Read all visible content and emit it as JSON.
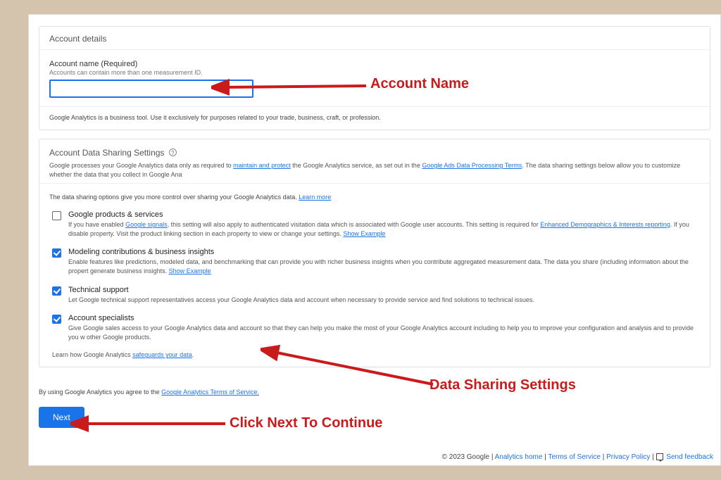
{
  "account_details": {
    "header": "Account details",
    "name_label": "Account name (Required)",
    "name_sublabel": "Accounts can contain more than one measurement ID.",
    "name_value": "",
    "disclaimer": "Google Analytics is a business tool. Use it exclusively for purposes related to your trade, business, craft, or profession."
  },
  "data_sharing": {
    "header": "Account Data Sharing Settings",
    "sub_pre": "Google processes your Google Analytics data only as required to ",
    "sub_link1": "maintain and protect",
    "sub_mid": " the Google Analytics service, as set out in the ",
    "sub_link2": "Google Ads Data Processing Terms",
    "sub_post": ". The data sharing settings below allow you to customize whether the data that you collect in Google Ana",
    "intro_pre": "The data sharing options give you more control over sharing your Google Analytics data. ",
    "intro_link": "Learn more",
    "items": [
      {
        "title": "Google products & services",
        "checked": false,
        "desc_pre": "If you have enabled ",
        "desc_link1": "Google signals",
        "desc_mid": ", this setting will also apply to authenticated visitation data which is associated with Google user accounts. This setting is required for ",
        "desc_link2": "Enhanced Demographics & Interests reporting",
        "desc_post": ". If you disable property. Visit the product linking section in each property to view or change your settings. ",
        "example": "Show Example"
      },
      {
        "title": "Modeling contributions & business insights",
        "checked": true,
        "desc": "Enable features like predictions, modeled data, and benchmarking that can provide you with richer business insights when you contribute aggregated measurement data. The data you share (including information about the propert generate business insights. ",
        "example": "Show Example"
      },
      {
        "title": "Technical support",
        "checked": true,
        "desc": "Let Google technical support representatives access your Google Analytics data and account when necessary to provide service and find solutions to technical issues."
      },
      {
        "title": "Account specialists",
        "checked": true,
        "desc": "Give Google sales access to your Google Analytics data and account so that they can help you make the most of your Google Analytics account including to help you to improve your configuration and analysis and to provide you w other Google products."
      }
    ],
    "safeguards_pre": "Learn how Google Analytics ",
    "safeguards_link": "safeguards your data",
    "safeguards_post": "."
  },
  "agree": {
    "pre": "By using Google Analytics you agree to the ",
    "link": "Google Analytics Terms of Service.",
    "post": ""
  },
  "next_label": "Next",
  "footer": {
    "copyright": "© 2023 Google",
    "sep": " | ",
    "analytics_home": "Analytics home",
    "terms": "Terms of Service",
    "privacy": "Privacy Policy",
    "feedback": "Send feedback"
  },
  "annotations": {
    "account_name": "Account Name",
    "data_sharing": "Data Sharing Settings",
    "click_next": "Click Next To Continue"
  }
}
